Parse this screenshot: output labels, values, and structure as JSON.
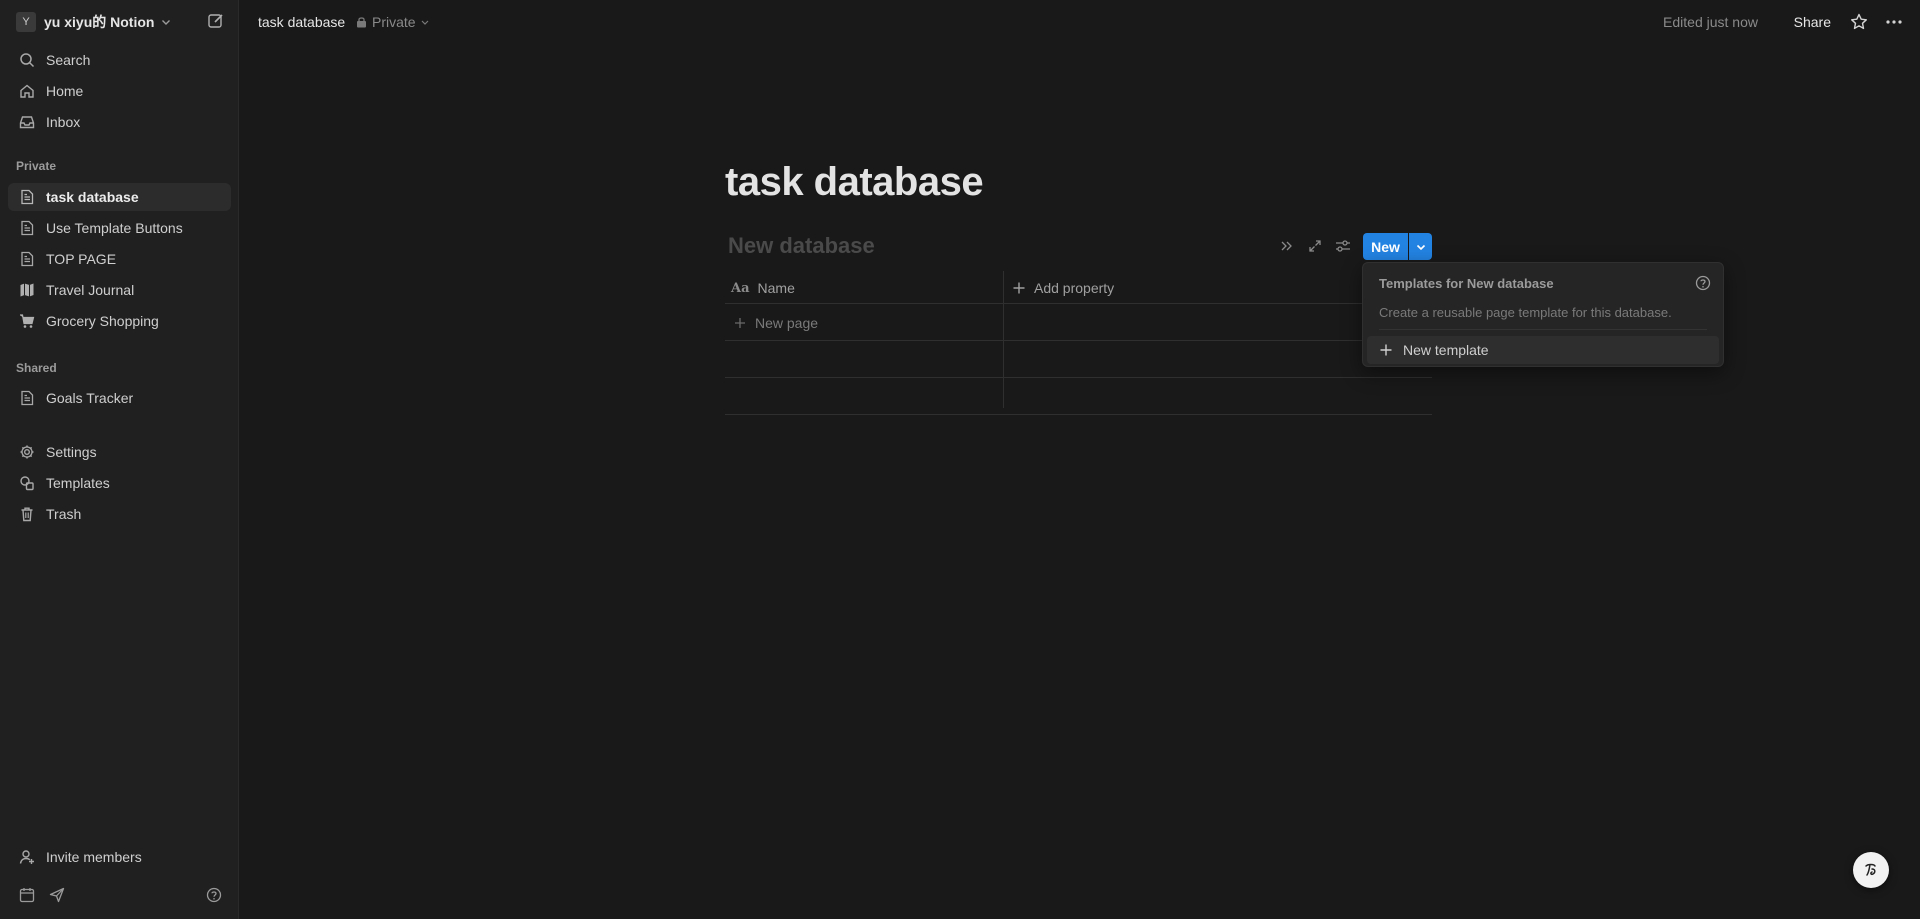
{
  "sidebar": {
    "workspace": {
      "avatar": "Y",
      "name": "yu xiyu的 Notion"
    },
    "top_items": [
      {
        "label": "Search",
        "icon": "search-icon"
      },
      {
        "label": "Home",
        "icon": "home-icon"
      },
      {
        "label": "Inbox",
        "icon": "inbox-icon"
      }
    ],
    "private_label": "Private",
    "private_items": [
      {
        "label": "task database",
        "icon": "page-icon"
      },
      {
        "label": "Use Template Buttons",
        "icon": "page-icon"
      },
      {
        "label": "TOP PAGE",
        "icon": "page-icon"
      },
      {
        "label": "Travel Journal",
        "icon": "map-icon"
      },
      {
        "label": "Grocery Shopping",
        "icon": "cart-icon"
      }
    ],
    "shared_label": "Shared",
    "shared_items": [
      {
        "label": "Goals Tracker",
        "icon": "page-icon"
      }
    ],
    "utility_items": [
      {
        "label": "Settings",
        "icon": "gear-icon"
      },
      {
        "label": "Templates",
        "icon": "templates-icon"
      },
      {
        "label": "Trash",
        "icon": "trash-icon"
      }
    ],
    "invite_label": "Invite members"
  },
  "topbar": {
    "title": "task database",
    "privacy": "Private",
    "edited": "Edited just now",
    "share": "Share"
  },
  "page": {
    "title": "task database",
    "database_title": "New database",
    "new_button": "New",
    "columns": {
      "name": "Name",
      "name_icon_text": "Aa",
      "add_property": "Add property"
    },
    "new_page_label": "New page"
  },
  "templates_popup": {
    "title": "Templates for New database",
    "description": "Create a reusable page template for this database.",
    "new_template": "New template"
  },
  "colors": {
    "accent": "#2383e2",
    "background": "#191919",
    "sidebar": "#202020"
  }
}
